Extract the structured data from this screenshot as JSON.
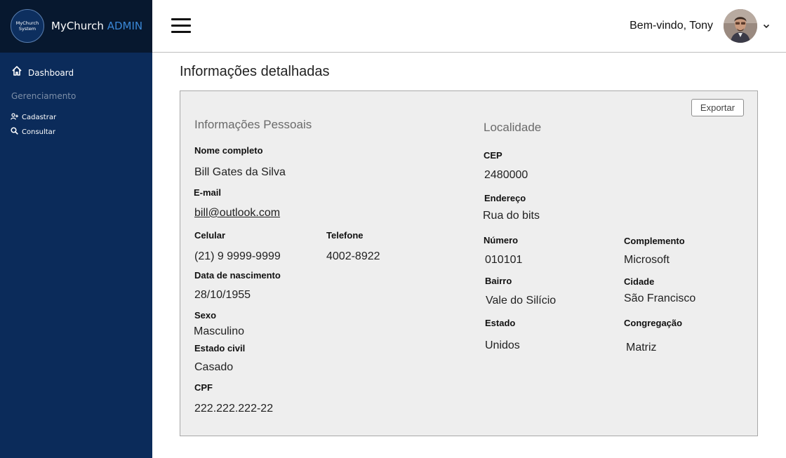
{
  "brand": {
    "logo_line1": "MyChurch",
    "logo_line2": "System",
    "name": "MyChurch",
    "name_suffix": "ADMIN"
  },
  "sidebar": {
    "dashboard": "Dashboard",
    "section": "Gerenciamento",
    "items": [
      {
        "label": "Cadastrar",
        "icon": "add-user-icon"
      },
      {
        "label": "Consultar",
        "icon": "search-icon"
      }
    ]
  },
  "header": {
    "welcome": "Bem-vindo, Tony"
  },
  "page": {
    "title": "Informações detalhadas",
    "export_label": "Exportar"
  },
  "personal": {
    "title": "Informações Pessoais",
    "full_name_label": "Nome completo",
    "full_name": "Bill Gates da Silva",
    "email_label": "E-mail",
    "email": "bill@outlook.com",
    "mobile_label": "Celular",
    "mobile": "(21) 9 9999-9999",
    "phone_label": "Telefone",
    "phone": "4002-8922",
    "birth_label": "Data de nascimento",
    "birth": "28/10/1955",
    "sex_label": "Sexo",
    "sex": "Masculino",
    "marital_label": "Estado civil",
    "marital": "Casado",
    "cpf_label": "CPF",
    "cpf": "222.222.222-22"
  },
  "location": {
    "title": "Localidade",
    "cep_label": "CEP",
    "cep": "2480000",
    "address_label": "Endereço",
    "address": "Rua do bits",
    "number_label": "Número",
    "number": "010101",
    "complement_label": "Complemento",
    "complement": "Microsoft",
    "district_label": "Bairro",
    "district": "Vale do Silício",
    "city_label": "Cidade",
    "city": "São Francisco",
    "state_label": "Estado",
    "state": "Unidos",
    "congregation_label": "Congregação",
    "congregation": "Matriz"
  },
  "colors": {
    "sidebar": "#0b2b5a",
    "brand_bar": "#07182f",
    "accent": "#3a87d6",
    "panel": "#eeeeee"
  }
}
